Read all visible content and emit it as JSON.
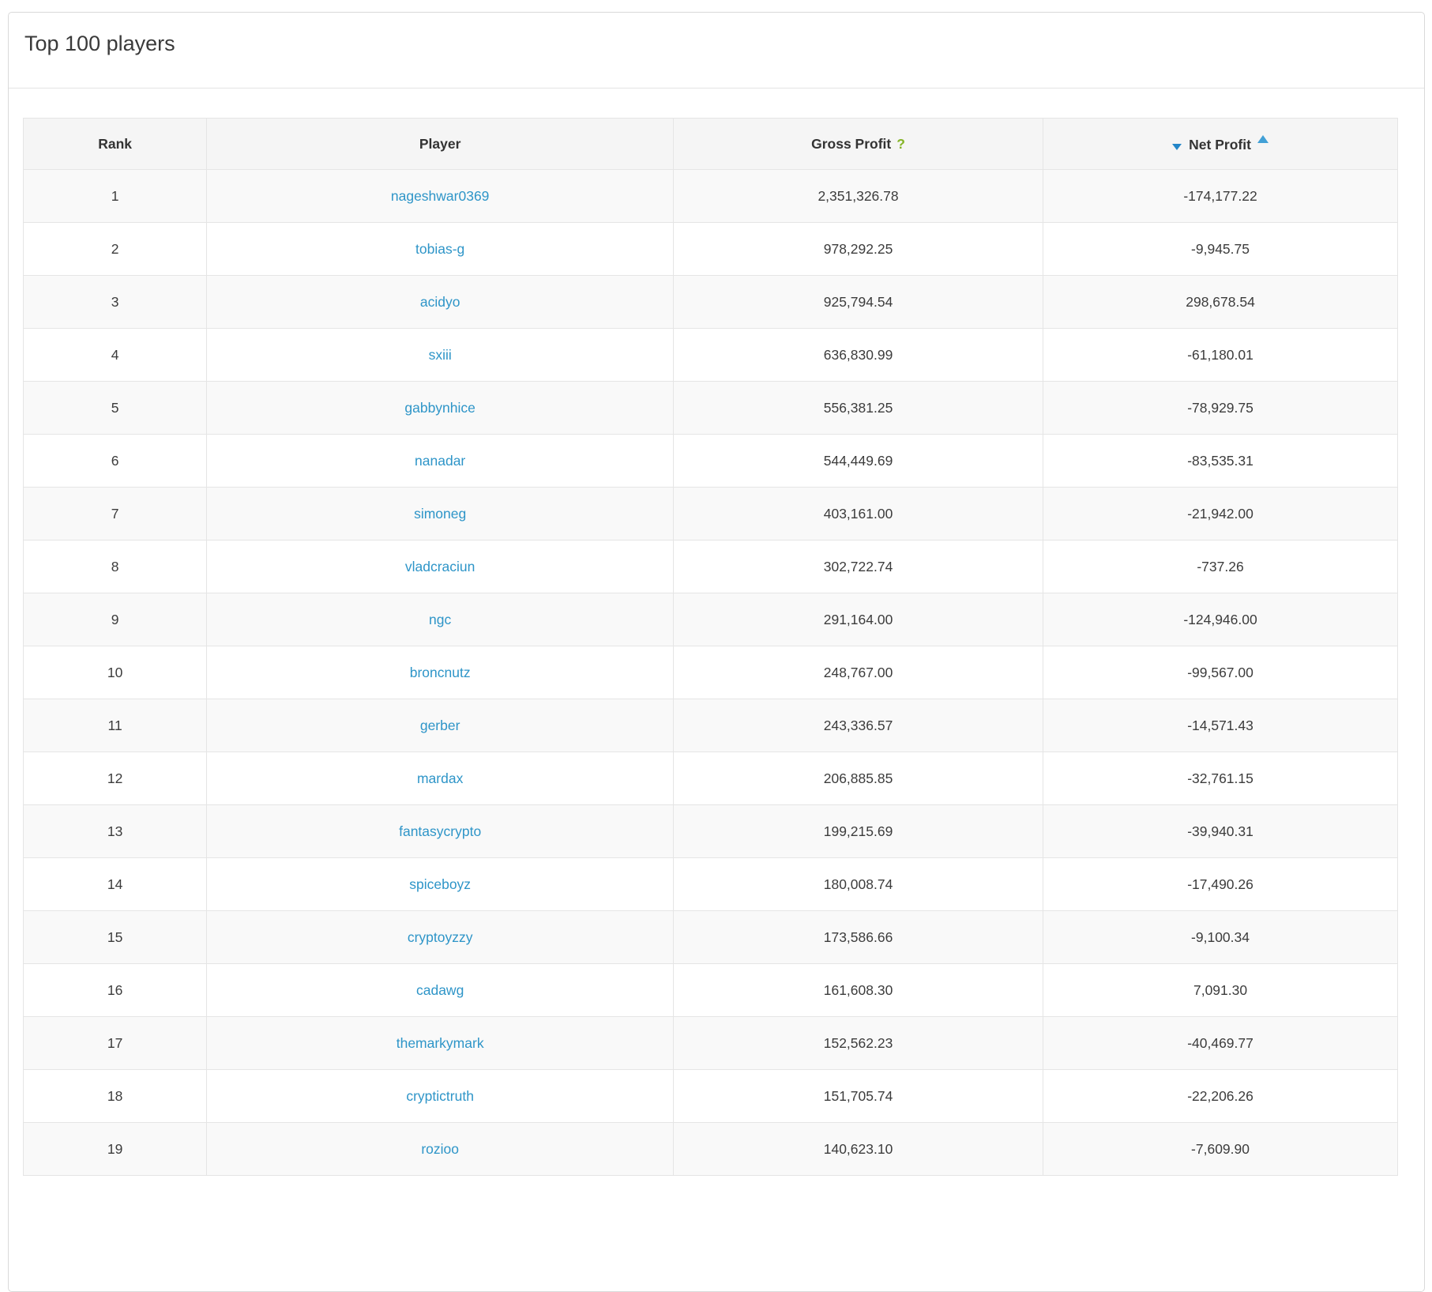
{
  "card": {
    "title": "Top 100 players"
  },
  "table": {
    "columns": [
      {
        "key": "rank",
        "label": "Rank"
      },
      {
        "key": "player",
        "label": "Player"
      },
      {
        "key": "gross",
        "label": "Gross Profit",
        "help": "?"
      },
      {
        "key": "net",
        "label": "Net Profit",
        "sort_icons": [
          "sort-desc-icon",
          "sort-asc-icon"
        ],
        "sort_state": "ascending"
      }
    ],
    "rows": [
      {
        "rank": "1",
        "player": "nageshwar0369",
        "gross": "2,351,326.78",
        "net": "-174,177.22"
      },
      {
        "rank": "2",
        "player": "tobias-g",
        "gross": "978,292.25",
        "net": "-9,945.75"
      },
      {
        "rank": "3",
        "player": "acidyo",
        "gross": "925,794.54",
        "net": "298,678.54"
      },
      {
        "rank": "4",
        "player": "sxiii",
        "gross": "636,830.99",
        "net": "-61,180.01"
      },
      {
        "rank": "5",
        "player": "gabbynhice",
        "gross": "556,381.25",
        "net": "-78,929.75"
      },
      {
        "rank": "6",
        "player": "nanadar",
        "gross": "544,449.69",
        "net": "-83,535.31"
      },
      {
        "rank": "7",
        "player": "simoneg",
        "gross": "403,161.00",
        "net": "-21,942.00"
      },
      {
        "rank": "8",
        "player": "vladcraciun",
        "gross": "302,722.74",
        "net": "-737.26"
      },
      {
        "rank": "9",
        "player": "ngc",
        "gross": "291,164.00",
        "net": "-124,946.00"
      },
      {
        "rank": "10",
        "player": "broncnutz",
        "gross": "248,767.00",
        "net": "-99,567.00"
      },
      {
        "rank": "11",
        "player": "gerber",
        "gross": "243,336.57",
        "net": "-14,571.43"
      },
      {
        "rank": "12",
        "player": "mardax",
        "gross": "206,885.85",
        "net": "-32,761.15"
      },
      {
        "rank": "13",
        "player": "fantasycrypto",
        "gross": "199,215.69",
        "net": "-39,940.31"
      },
      {
        "rank": "14",
        "player": "spiceboyz",
        "gross": "180,008.74",
        "net": "-17,490.26"
      },
      {
        "rank": "15",
        "player": "cryptoyzzy",
        "gross": "173,586.66",
        "net": "-9,100.34"
      },
      {
        "rank": "16",
        "player": "cadawg",
        "gross": "161,608.30",
        "net": "7,091.30"
      },
      {
        "rank": "17",
        "player": "themarkymark",
        "gross": "152,562.23",
        "net": "-40,469.77"
      },
      {
        "rank": "18",
        "player": "cryptictruth",
        "gross": "151,705.74",
        "net": "-22,206.26"
      },
      {
        "rank": "19",
        "player": "rozioo",
        "gross": "140,623.10",
        "net": "-7,609.90"
      }
    ]
  },
  "colors": {
    "link": "#2e95c8",
    "help_icon": "#85b427",
    "sort_icon": "#2386c8",
    "header_bg": "#f5f5f5",
    "stripe_bg": "#f9f9f9",
    "border": "#dddddd",
    "text": "#3c3c3c"
  }
}
